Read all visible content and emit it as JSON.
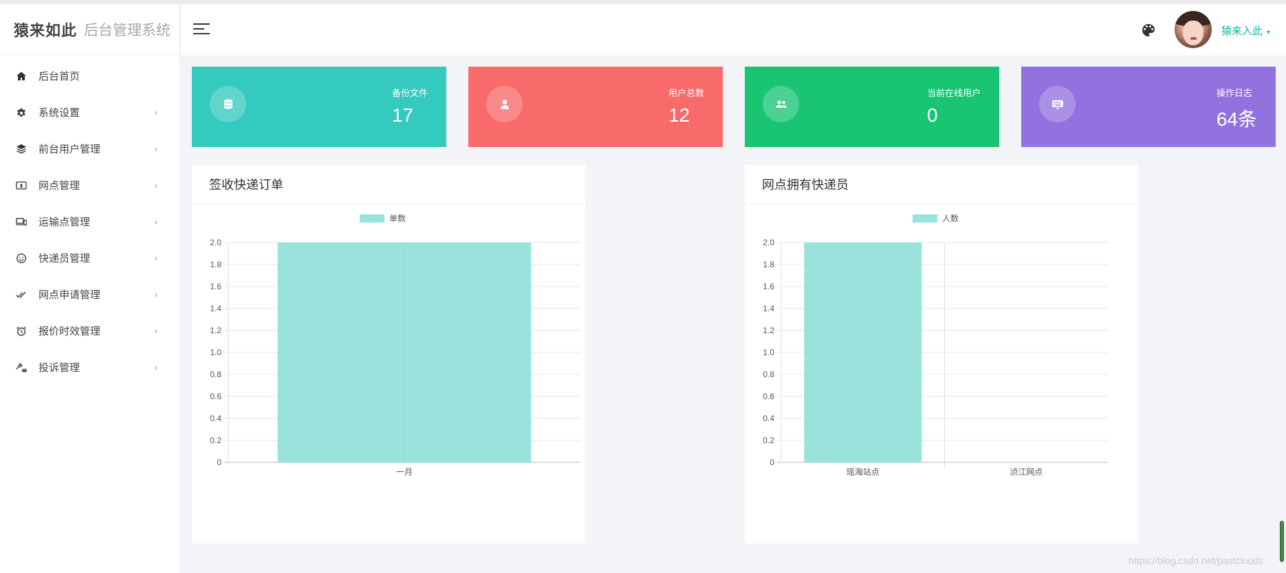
{
  "brand": {
    "logo_text": "猿来如此",
    "system_name": "后台管理系统"
  },
  "sidebar": {
    "items": [
      {
        "label": "后台首页",
        "icon": "home-icon",
        "has_children": false
      },
      {
        "label": "系统设置",
        "icon": "gear-icon",
        "has_children": true
      },
      {
        "label": "前台用户管理",
        "icon": "layers-icon",
        "has_children": true
      },
      {
        "label": "网点管理",
        "icon": "id-card-icon",
        "has_children": true
      },
      {
        "label": "运输点管理",
        "icon": "devices-icon",
        "has_children": true
      },
      {
        "label": "快递员管理",
        "icon": "smile-icon",
        "has_children": true
      },
      {
        "label": "网点申请管理",
        "icon": "double-check-icon",
        "has_children": true
      },
      {
        "label": "报价时效管理",
        "icon": "alarm-clock-icon",
        "has_children": true
      },
      {
        "label": "投诉管理",
        "icon": "gavel-icon",
        "has_children": true
      }
    ],
    "chevron": "›"
  },
  "header": {
    "username": "猿来入此",
    "caret": "▾"
  },
  "stats": [
    {
      "label": "备份文件",
      "value": "17",
      "icon": "database-icon",
      "color": "#34cabe"
    },
    {
      "label": "用户总数",
      "value": "12",
      "icon": "user-icon",
      "color": "#f96a6a"
    },
    {
      "label": "当前在线用户",
      "value": "0",
      "icon": "users-icon",
      "color": "#19c473"
    },
    {
      "label": "操作日志",
      "value": "64条",
      "icon": "keyboard-icon",
      "color": "#9272de"
    }
  ],
  "panels": [
    {
      "title": "签收快递订单"
    },
    {
      "title": "网点拥有快递员"
    }
  ],
  "chart_data": [
    {
      "type": "bar",
      "categories": [
        "一月"
      ],
      "series": [
        {
          "name": "单数",
          "values": [
            2
          ]
        }
      ],
      "ylim": [
        0,
        2.0
      ],
      "yticks": [
        "0",
        "0.2",
        "0.4",
        "0.6",
        "0.8",
        "1.0",
        "1.2",
        "1.4",
        "1.6",
        "1.8",
        "2.0"
      ],
      "legend": "top-center",
      "grid": true,
      "bar_color": "#9ae3dc"
    },
    {
      "type": "bar",
      "categories": [
        "瑶海站点",
        "浈江网点"
      ],
      "series": [
        {
          "name": "人数",
          "values": [
            2,
            0
          ]
        }
      ],
      "ylim": [
        0,
        2.0
      ],
      "yticks": [
        "0",
        "0.2",
        "0.4",
        "0.6",
        "0.8",
        "1.0",
        "1.2",
        "1.4",
        "1.6",
        "1.8",
        "2.0"
      ],
      "legend": "top-center",
      "grid": true,
      "bar_color": "#9ae3dc"
    }
  ],
  "watermark": "https://blog.csdn.net/pastclouds"
}
